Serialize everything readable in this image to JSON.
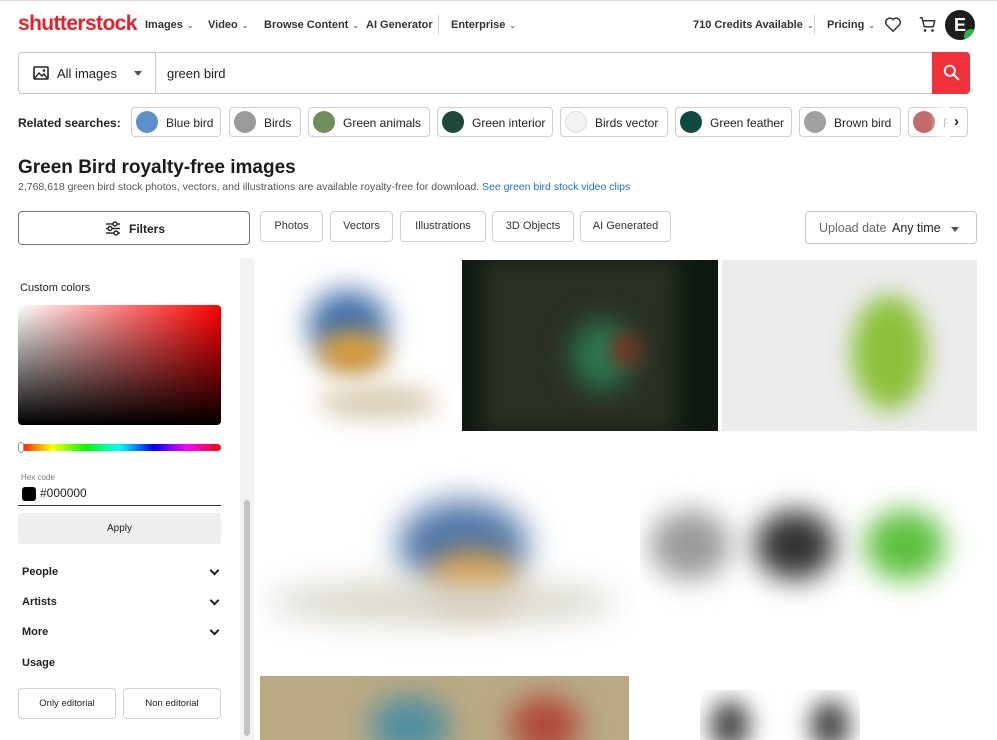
{
  "header": {
    "logo": "shutterstock",
    "nav": [
      {
        "label": "Images",
        "has_menu": true
      },
      {
        "label": "Video",
        "has_menu": true
      },
      {
        "label": "Browse Content",
        "has_menu": true
      },
      {
        "label": "AI Generator",
        "has_menu": false
      },
      {
        "label": "Enterprise",
        "has_menu": true
      }
    ],
    "credits": "710 Credits Available",
    "pricing": "Pricing",
    "avatar_letter": "E",
    "icons": [
      "heart-icon",
      "cart-icon"
    ]
  },
  "search": {
    "type_label": "All images",
    "query": "green bird",
    "type_icon": "image-icon",
    "button_icon": "search-icon"
  },
  "related": {
    "label": "Related searches:",
    "items": [
      {
        "label": "Blue bird",
        "color": "#5b8fc7"
      },
      {
        "label": "Birds",
        "color": "#9a9a9a"
      },
      {
        "label": "Green animals",
        "color": "#6f8f5a"
      },
      {
        "label": "Green interior",
        "color": "#1f4a3a"
      },
      {
        "label": "Birds vector",
        "color": "#f2f2f2"
      },
      {
        "label": "Green feather",
        "color": "#0f4a42"
      },
      {
        "label": "Brown bird",
        "color": "#a0a0a0"
      },
      {
        "label": "F",
        "color": "#c46a6a"
      }
    ]
  },
  "page": {
    "title": "Green Bird royalty-free images",
    "subtitle": "2,768,618 green bird stock photos, vectors, and illustrations are available royalty-free for download.",
    "video_link": "See green bird stock video clips"
  },
  "filterbar": {
    "filters_label": "Filters",
    "chips": [
      "Photos",
      "Vectors",
      "Illustrations",
      "3D Objects",
      "AI Generated"
    ],
    "upload_label": "Upload date",
    "upload_value": "Any time"
  },
  "sidebar": {
    "custom_colors": "Custom colors",
    "hex_label": "Hex code",
    "hex_value": "#000000",
    "apply": "Apply",
    "sections": [
      "People",
      "Artists",
      "More"
    ],
    "usage": "Usage",
    "usage_options": [
      "Only editorial",
      "Non editorial"
    ]
  },
  "colors": {
    "brand_red": "#e8202c",
    "search_red": "#f0313a",
    "link_blue": "#1a73c8"
  }
}
